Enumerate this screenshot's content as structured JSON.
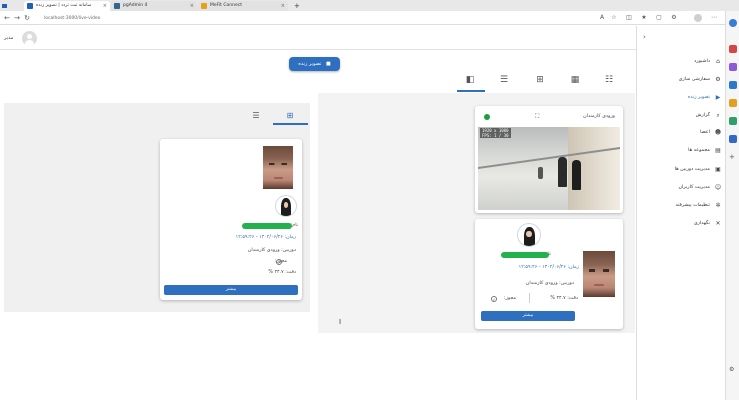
{
  "browser": {
    "tabs": [
      {
        "label": "سامانه ثبت تردد | تصویر زنده",
        "color": "#1f5fb8",
        "active": true
      },
      {
        "label": "pgAdmin 4",
        "color": "#336791",
        "active": false
      },
      {
        "label": "MeFit Connect",
        "color": "#e8a11a",
        "active": false
      }
    ],
    "new_tab": "+",
    "url": "localhost:3000/live-video"
  },
  "header": {
    "username": "مدیر"
  },
  "live_button": "تصویر زنده",
  "camera": {
    "name": "ورودی کارمندان",
    "overlay_line1": "1920 x 1080",
    "overlay_line2": "FPS: 1 / 30"
  },
  "detection_right": {
    "name_label": "نام:",
    "time_value": "زمان: ۱۴۰۲/۰۶/۲۶ - ۱۲:۵۹:۲۶",
    "camera_value": "دوربین: ورودی کارمندان",
    "accuracy_value": "دقت: ۴۴.۷ %",
    "permitted_value": "مجوز:",
    "button": "بیشتر"
  },
  "detection_left": {
    "name_label": "نام:",
    "time_value": "زمان: ۱۴۰۲/۰۶/۲۶ - ۱۲:۵۹:۲۶",
    "camera_value": "دوربین: ورودی کارمندان",
    "permitted_value": "مجوز:",
    "accuracy_value": "دقت: ۴۴.۷ %",
    "button": "بیشتر"
  },
  "sidebar": {
    "items": [
      {
        "label": "داشبورد",
        "icon": "home-icon",
        "glyph": "⌂",
        "active": false
      },
      {
        "label": "سفارشی سازی",
        "icon": "gear-icon",
        "glyph": "⚙",
        "active": false
      },
      {
        "label": "تصویر زنده",
        "icon": "camera-icon",
        "glyph": "▶",
        "active": true
      },
      {
        "label": "گزارش",
        "icon": "search-icon",
        "glyph": "⌕",
        "active": false
      },
      {
        "label": "اعضا",
        "icon": "users-icon",
        "glyph": "☻",
        "active": false
      },
      {
        "label": "مجموعه ها",
        "icon": "folder-icon",
        "glyph": "▤",
        "active": false
      },
      {
        "label": "مدیریت دوربین ها",
        "icon": "video-icon",
        "glyph": "▣",
        "active": false
      },
      {
        "label": "مدیریت کاربران",
        "icon": "user-cog-icon",
        "glyph": "☺",
        "active": false
      },
      {
        "label": "تنظیمات پیشرفته",
        "icon": "settings-icon",
        "glyph": "✲",
        "active": false
      },
      {
        "label": "نگهداری",
        "icon": "wrench-icon",
        "glyph": "✕",
        "active": false
      }
    ]
  },
  "colors": {
    "primary": "#2f6fbf",
    "success": "#23b14d",
    "status_online": "#1f9d3a"
  }
}
